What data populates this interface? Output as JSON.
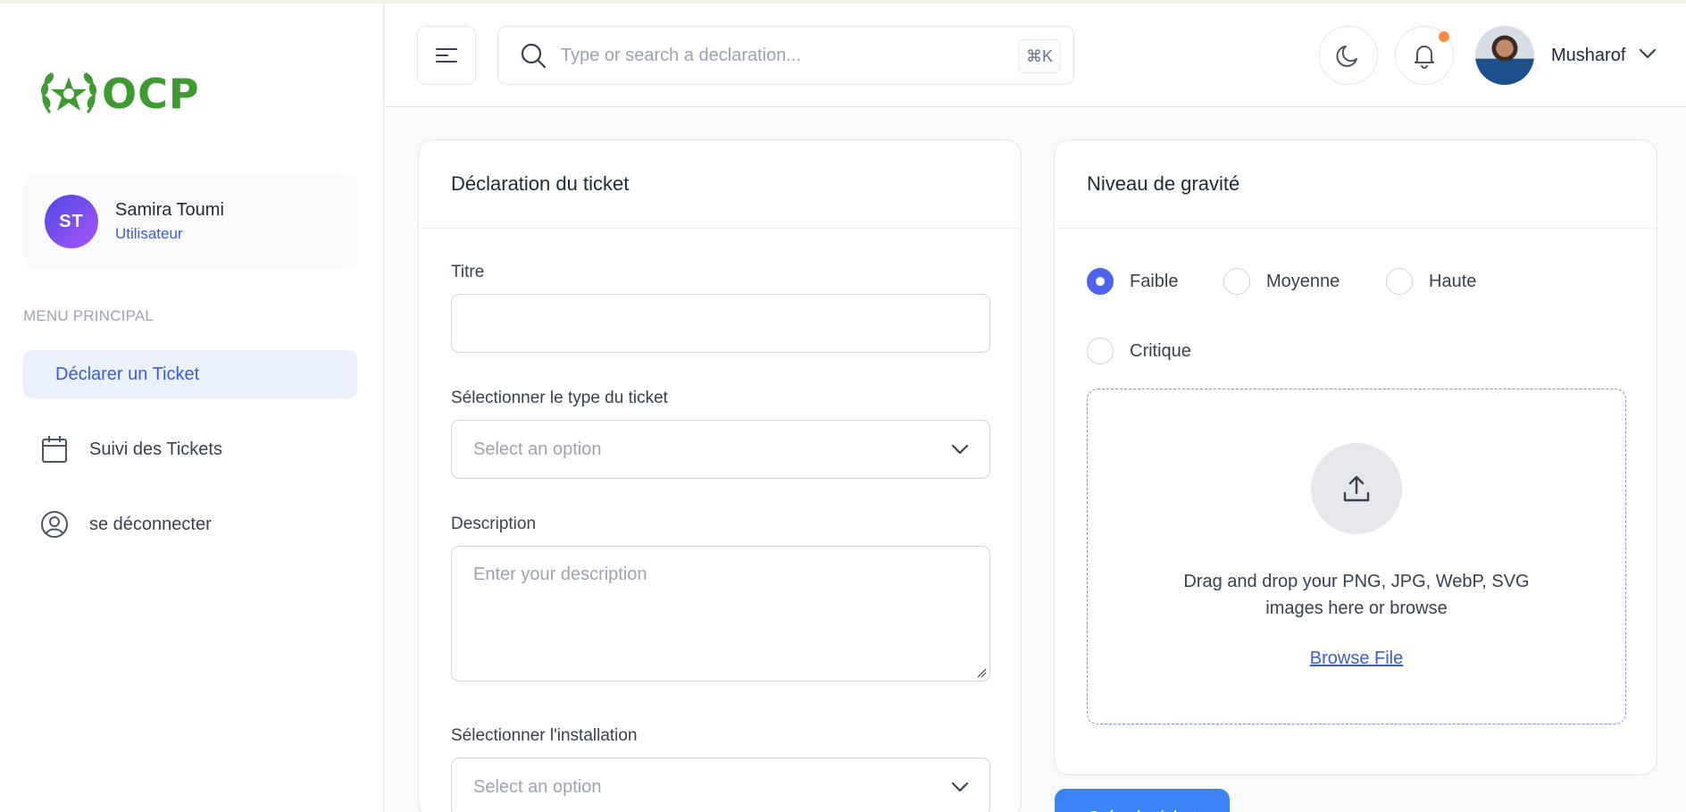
{
  "sidebar": {
    "logo_text": "OCP",
    "user": {
      "initials": "ST",
      "name": "Samira Toumi",
      "role": "Utilisateur"
    },
    "menu_heading": "MENU PRINCIPAL",
    "items": [
      {
        "label": "Déclarer un Ticket",
        "icon": "none",
        "active": true
      },
      {
        "label": "Suivi des Tickets",
        "icon": "calendar-icon",
        "active": false
      },
      {
        "label": "se déconnecter",
        "icon": "user-circle-icon",
        "active": false
      }
    ]
  },
  "header": {
    "search": {
      "placeholder": "Type or search a declaration...",
      "value": "",
      "shortcut": "⌘K"
    },
    "profile_name": "Musharof",
    "colors": {
      "notification_dot": "#fb8c3c"
    }
  },
  "form": {
    "title": "Déclaration du ticket",
    "titre_label": "Titre",
    "titre_value": "",
    "type_label": "Sélectionner le type du ticket",
    "type_selected": "Select an option",
    "description_label": "Description",
    "description_placeholder": "Enter your description",
    "installation_label": "Sélectionner l'installation",
    "installation_selected": "Select an option"
  },
  "severity": {
    "title": "Niveau de gravité",
    "options": [
      {
        "label": "Faible",
        "checked": true
      },
      {
        "label": "Moyenne",
        "checked": false
      },
      {
        "label": "Haute",
        "checked": false
      },
      {
        "label": "Critique",
        "checked": false
      }
    ],
    "dropzone_text_line1": "Drag and drop your PNG, JPG, WebP, SVG",
    "dropzone_text_line2": "images here or browse",
    "browse_label": "Browse File"
  },
  "submit_label": "Créer le ticket",
  "colors": {
    "accent": "#3b5bdb",
    "radio_checked": "#4f63f0",
    "logo_green": "#3f9a32",
    "submit": "#3b82f6"
  }
}
